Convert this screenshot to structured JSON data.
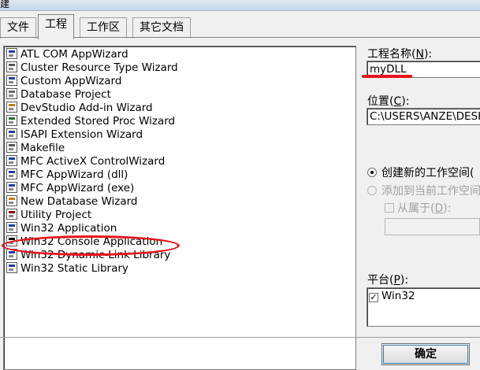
{
  "window": {
    "title_fragment": "建"
  },
  "tabs": [
    {
      "label": "文件",
      "active": false
    },
    {
      "label": "工程",
      "active": true
    },
    {
      "label": "工作区",
      "active": false
    },
    {
      "label": "其它文档",
      "active": false
    }
  ],
  "project_types": [
    {
      "label": "ATL COM AppWizard",
      "icon": "atl-icon",
      "color": "#1a3fa8"
    },
    {
      "label": "Cluster Resource Type Wizard",
      "icon": "cluster-icon",
      "color": "#555555"
    },
    {
      "label": "Custom AppWizard",
      "icon": "custom-wizard-icon",
      "color": "#1a3fa8"
    },
    {
      "label": "Database Project",
      "icon": "database-icon",
      "color": "#6a6a6a"
    },
    {
      "label": "DevStudio Add-in Wizard",
      "icon": "addin-icon",
      "color": "#b8860b"
    },
    {
      "label": "Extended Stored Proc Wizard",
      "icon": "stored-proc-icon",
      "color": "#2a6d2a"
    },
    {
      "label": "ISAPI Extension Wizard",
      "icon": "isapi-icon",
      "color": "#1a3fa8"
    },
    {
      "label": "Makefile",
      "icon": "makefile-icon",
      "color": "#555555"
    },
    {
      "label": "MFC ActiveX ControlWizard",
      "icon": "activex-icon",
      "color": "#1a3fa8"
    },
    {
      "label": "MFC AppWizard (dll)",
      "icon": "mfc-dll-icon",
      "color": "#1a3fa8"
    },
    {
      "label": "MFC AppWizard (exe)",
      "icon": "mfc-exe-icon",
      "color": "#1a3fa8"
    },
    {
      "label": "New Database Wizard",
      "icon": "new-db-icon",
      "color": "#b8860b"
    },
    {
      "label": "Utility Project",
      "icon": "utility-icon",
      "color": "#8b0000"
    },
    {
      "label": "Win32 Application",
      "icon": "win32-app-icon",
      "color": "#1a3fa8"
    },
    {
      "label": "Win32 Console Application",
      "icon": "console-icon",
      "color": "#000000"
    },
    {
      "label": "Win32 Dynamic-Link Library",
      "icon": "dll-icon",
      "color": "#1a3fa8",
      "highlighted": true
    },
    {
      "label": "Win32 Static Library",
      "icon": "static-lib-icon",
      "color": "#1a3fa8"
    }
  ],
  "project_name": {
    "label": "工程名称(",
    "mnemonic": "N",
    "label_end": "):",
    "value": "myDLL"
  },
  "location": {
    "label": "位置(",
    "mnemonic": "C",
    "label_end": "):",
    "value": "C:\\USERS\\ANZE\\DESKTOP"
  },
  "workspace_options": {
    "create_new": "创建新的工作空间(",
    "add_to_current": "添加到当前工作空间(",
    "dependency": {
      "label": "从属于(",
      "mnemonic": "D",
      "label_end": "):"
    }
  },
  "platform": {
    "label": "平台(",
    "mnemonic": "P",
    "label_end": "):",
    "options": [
      {
        "label": "Win32",
        "checked": true
      }
    ]
  },
  "buttons": {
    "ok": "确定"
  },
  "colors": {
    "annotation_red": "#e8131b",
    "dialog_bg": "#f0f0f0"
  }
}
